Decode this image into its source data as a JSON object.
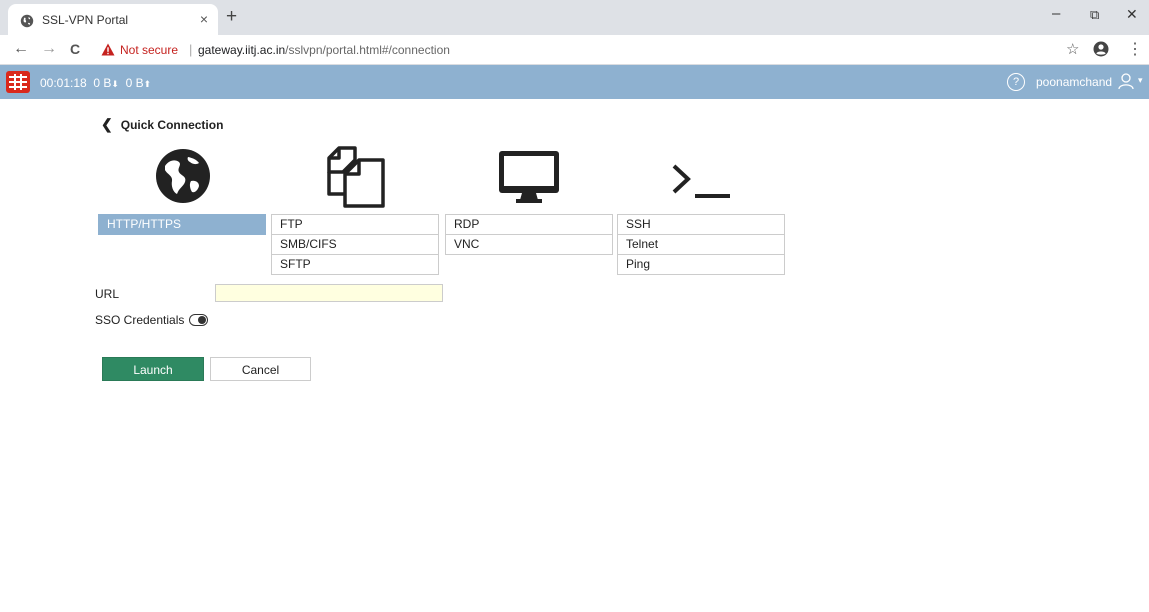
{
  "browser": {
    "tab_title": "SSL-VPN Portal",
    "tab_close": "×",
    "new_tab": "+",
    "win_minimize": "–",
    "win_restore": "⧉",
    "win_close": "✕",
    "nav_back": "←",
    "nav_forward": "→",
    "reload": "C",
    "not_secure": "Not secure",
    "separator": "|",
    "url_host": "gateway.iitj.ac.in",
    "url_path": "/sslvpn/portal.html#/connection",
    "bookmark_star": "☆",
    "menu_kebab": "⋮"
  },
  "header": {
    "timer": "00:01:18",
    "download": "0 B",
    "upload": "0 B",
    "download_arrow": "⬇",
    "upload_arrow": "⬆",
    "help": "?",
    "username": "poonamchand",
    "caret": "▾",
    "brand_color": "#da291c",
    "bar_color": "#8eb1d0"
  },
  "quick_connection": {
    "back_chevron": "❮",
    "title": "Quick Connection",
    "icons": [
      "globe-icon",
      "files-icon",
      "monitor-icon",
      "terminal-icon"
    ],
    "columns": [
      [
        "HTTP/HTTPS"
      ],
      [
        "FTP",
        "SMB/CIFS",
        "SFTP"
      ],
      [
        "RDP",
        "VNC"
      ],
      [
        "SSH",
        "Telnet",
        "Ping"
      ]
    ],
    "selected": "HTTP/HTTPS",
    "url_label": "URL",
    "url_value": "",
    "url_placeholder": "",
    "sso_label": "SSO Credentials",
    "sso_enabled": false,
    "launch": "Launch",
    "cancel": "Cancel",
    "launch_color": "#2f8a63"
  }
}
